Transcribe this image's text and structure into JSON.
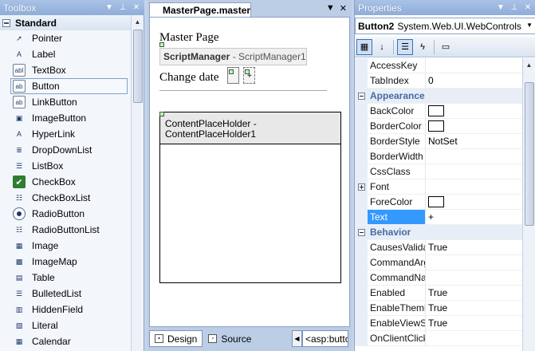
{
  "toolbox": {
    "title": "Toolbox",
    "group": "Standard",
    "items": [
      {
        "label": "Pointer",
        "icon": "pointer-icon",
        "glyph": "➚"
      },
      {
        "label": "Label",
        "icon": "label-icon",
        "glyph": "A"
      },
      {
        "label": "TextBox",
        "icon": "textbox-icon",
        "glyph": "abl"
      },
      {
        "label": "Button",
        "icon": "button-icon",
        "glyph": "ab",
        "selected": true
      },
      {
        "label": "LinkButton",
        "icon": "linkbutton-icon",
        "glyph": "ab"
      },
      {
        "label": "ImageButton",
        "icon": "imagebutton-icon",
        "glyph": "▣"
      },
      {
        "label": "HyperLink",
        "icon": "hyperlink-icon",
        "glyph": "A"
      },
      {
        "label": "DropDownList",
        "icon": "dropdownlist-icon",
        "glyph": "≣"
      },
      {
        "label": "ListBox",
        "icon": "listbox-icon",
        "glyph": "☰"
      },
      {
        "label": "CheckBox",
        "icon": "checkbox-icon",
        "glyph": "✔"
      },
      {
        "label": "CheckBoxList",
        "icon": "checkboxlist-icon",
        "glyph": "☷"
      },
      {
        "label": "RadioButton",
        "icon": "radiobutton-icon",
        "glyph": ""
      },
      {
        "label": "RadioButtonList",
        "icon": "radiobuttonlist-icon",
        "glyph": "☷"
      },
      {
        "label": "Image",
        "icon": "image-icon",
        "glyph": "▦"
      },
      {
        "label": "ImageMap",
        "icon": "imagemap-icon",
        "glyph": "▩"
      },
      {
        "label": "Table",
        "icon": "table-icon",
        "glyph": "▤"
      },
      {
        "label": "BulletedList",
        "icon": "bulletedlist-icon",
        "glyph": "☰"
      },
      {
        "label": "HiddenField",
        "icon": "hiddenfield-icon",
        "glyph": "▥"
      },
      {
        "label": "Literal",
        "icon": "literal-icon",
        "glyph": "▧"
      },
      {
        "label": "Calendar",
        "icon": "calendar-icon",
        "glyph": "▦"
      }
    ]
  },
  "editor": {
    "tab_title": "MasterPage.master",
    "master_label": "Master Page",
    "scriptmanager_bold": "ScriptManager",
    "scriptmanager_rest": " - ScriptManager1",
    "change_label": "Change date",
    "cph_line1": "ContentPlaceHolder -",
    "cph_line2": "ContentPlaceHolder1",
    "design_label": "Design",
    "source_label": "Source",
    "tag_path": "<asp:button>"
  },
  "properties": {
    "title": "Properties",
    "object_name": "Button2",
    "object_type": "System.Web.UI.WebControls",
    "rows": [
      {
        "kind": "prop",
        "name": "AccessKey",
        "value": ""
      },
      {
        "kind": "prop",
        "name": "TabIndex",
        "value": "0"
      },
      {
        "kind": "cat",
        "name": "Appearance"
      },
      {
        "kind": "prop",
        "name": "BackColor",
        "value": "",
        "swatch": true
      },
      {
        "kind": "prop",
        "name": "BorderColor",
        "value": "",
        "swatch": true
      },
      {
        "kind": "prop",
        "name": "BorderStyle",
        "value": "NotSet"
      },
      {
        "kind": "prop",
        "name": "BorderWidth",
        "value": ""
      },
      {
        "kind": "prop",
        "name": "CssClass",
        "value": ""
      },
      {
        "kind": "prop",
        "name": "Font",
        "value": "",
        "expandable": true
      },
      {
        "kind": "prop",
        "name": "ForeColor",
        "value": "",
        "swatch": true
      },
      {
        "kind": "prop",
        "name": "Text",
        "value": "+",
        "selected": true
      },
      {
        "kind": "cat",
        "name": "Behavior"
      },
      {
        "kind": "prop",
        "name": "CausesValidation",
        "value": "True"
      },
      {
        "kind": "prop",
        "name": "CommandArgument",
        "value": ""
      },
      {
        "kind": "prop",
        "name": "CommandName",
        "value": ""
      },
      {
        "kind": "prop",
        "name": "Enabled",
        "value": "True"
      },
      {
        "kind": "prop",
        "name": "EnableTheming",
        "value": "True"
      },
      {
        "kind": "prop",
        "name": "EnableViewState",
        "value": "True"
      },
      {
        "kind": "prop",
        "name": "OnClientClick",
        "value": ""
      }
    ]
  },
  "colors": {
    "titlebar": "#9bb6e0",
    "selection": "#3399ff",
    "category_text": "#466aa6"
  }
}
